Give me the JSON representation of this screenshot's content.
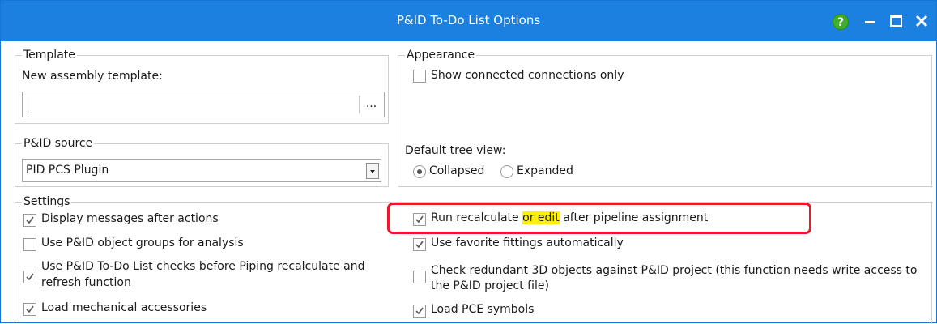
{
  "window": {
    "title": "P&ID To-Do List Options",
    "help_glyph": "?"
  },
  "template": {
    "legend": "Template",
    "label": "New assembly template:",
    "value": "",
    "browse_label": "..."
  },
  "pid_source": {
    "legend": "P&ID source",
    "selected": "PID PCS Plugin"
  },
  "appearance": {
    "legend": "Appearance",
    "show_connected_label": "Show connected connections only",
    "show_connected_checked": false,
    "default_tree_view_label": "Default tree view:",
    "options": [
      {
        "label": "Collapsed",
        "selected": true
      },
      {
        "label": "Expanded",
        "selected": false
      }
    ]
  },
  "settings": {
    "legend": "Settings",
    "left": [
      {
        "label": "Display messages after actions",
        "checked": true
      },
      {
        "label": "Use P&ID object groups for analysis",
        "checked": false
      },
      {
        "label_line1": "Use P&ID To-Do List checks before Piping recalculate and",
        "label_line2": "refresh function",
        "checked": true
      },
      {
        "label": "Load mechanical accessories",
        "checked": true
      }
    ],
    "right": [
      {
        "label_before": "Run recalculate ",
        "label_highlight": "or edit",
        "label_after": " after pipeline assignment",
        "checked": true
      },
      {
        "label": "Use favorite fittings automatically",
        "checked": true
      },
      {
        "label_line1": "Check redundant 3D objects against P&ID project (this function needs write access to",
        "label_line2": "the P&ID project file)",
        "checked": false
      },
      {
        "label": "Load PCE symbols",
        "checked": true
      }
    ]
  },
  "colors": {
    "titlebar": "#1b80e0",
    "highlight": "#fff200",
    "annotation_box": "#e8192c",
    "help_icon": "#3fae2a"
  }
}
